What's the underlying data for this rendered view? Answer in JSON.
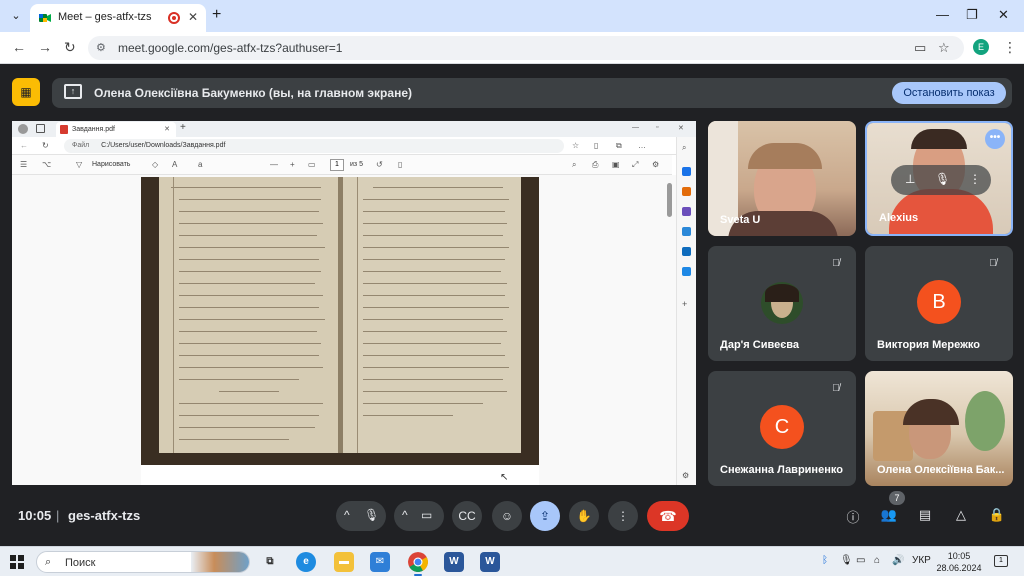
{
  "browser": {
    "tab_title": "Meet – ges-atfx-tzs",
    "url": "meet.google.com/ges-atfx-tzs?authuser=1",
    "profile_initial": "E"
  },
  "meet": {
    "presenting_text": "Олена Олексіївна Бакуменко (вы, на главном экране)",
    "stop_button": "Остановить показ",
    "time": "10:05",
    "code": "ges-atfx-tzs",
    "participant_count": "7"
  },
  "shared_screen": {
    "tab_title": "Завдання.pdf",
    "address_label": "Файл",
    "address_path": "C:/Users/user/Downloads/Завдання.pdf",
    "draw_label": "Нарисовать",
    "page_number": "1",
    "page_total": "из 5"
  },
  "participants": [
    {
      "name": "Sveta U",
      "type": "video",
      "muted": false
    },
    {
      "name": "Alexius",
      "type": "video",
      "muted": false,
      "highlighted": true
    },
    {
      "name": "Дар'я Сивеєва",
      "type": "photo",
      "muted": true
    },
    {
      "name": "Виктория Мережко",
      "type": "initial",
      "initial": "В",
      "color": "#f4511e",
      "muted": true
    },
    {
      "name": "Снежанна Лавриненко",
      "type": "initial",
      "initial": "С",
      "color": "#f4511e",
      "muted": true
    },
    {
      "name": "Олена Олексіївна Бак...",
      "type": "video",
      "muted": false
    }
  ],
  "taskbar": {
    "search_placeholder": "Поиск",
    "language": "УКР",
    "time": "10:05",
    "date": "28.06.2024",
    "notification_count": "1"
  },
  "colors": {
    "meet_bg": "#202124",
    "tile_bg": "#3c4043",
    "accent_blue": "#a8c7fa",
    "end_call_red": "#dc3626",
    "avatar_orange": "#f4511e",
    "present_yellow": "#fbbc04"
  }
}
